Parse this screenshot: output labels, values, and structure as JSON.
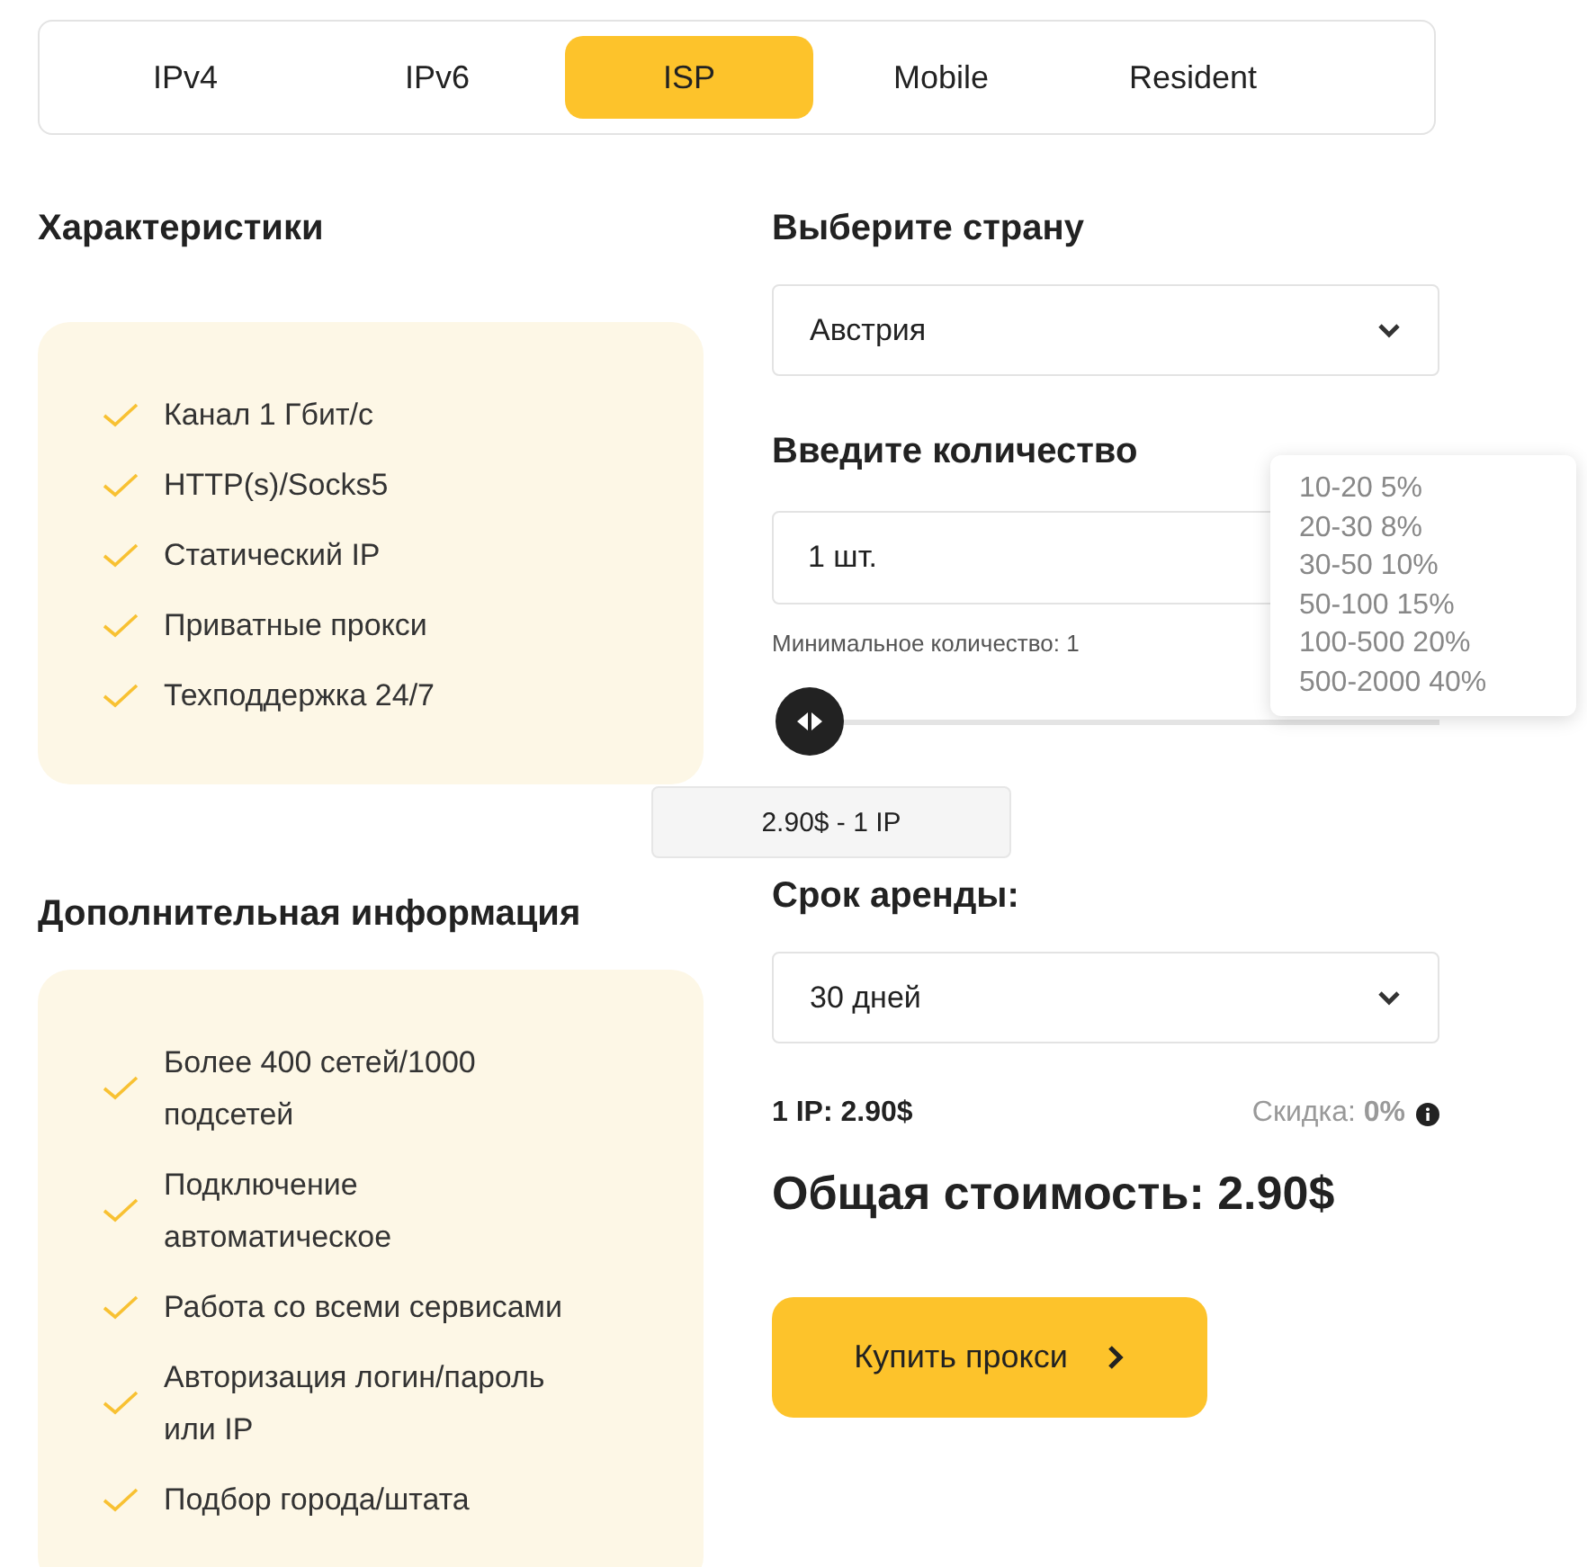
{
  "tabs": [
    {
      "label": "IPv4",
      "selected": false
    },
    {
      "label": "IPv6",
      "selected": false
    },
    {
      "label": "ISP",
      "selected": true
    },
    {
      "label": "Mobile",
      "selected": false
    },
    {
      "label": "Resident",
      "selected": false
    }
  ],
  "features": {
    "title": "Характеристики",
    "items": [
      "Канал 1 Гбит/с",
      "HTTP(s)/Socks5",
      "Статический IP",
      "Приватные прокси",
      "Техподдержка 24/7"
    ]
  },
  "extra_info": {
    "title": "Дополнительная информация",
    "items": [
      "Более 400 сетей/1000 подсетей",
      "Подключение автоматическое",
      "Работа со всеми сервисами",
      "Авторизация логин/пароль или IP",
      "Подбор города/штата"
    ]
  },
  "country": {
    "label": "Выберите страну",
    "value": "Австрия"
  },
  "quantity": {
    "label": "Введите количество",
    "value": "1 шт.",
    "hint": "Минимальное количество: 1",
    "level": 0,
    "price_tooltip": "2.90$ - 1 IP"
  },
  "discount_popup": [
    "10-20 5%",
    "20-30 8%",
    "30-50 10%",
    "50-100 15%",
    "100-500 20%",
    "500-2000 40%"
  ],
  "period": {
    "label": "Срок аренды:",
    "value": "30 дней"
  },
  "unit_price": "1 IP: 2.90$",
  "discount": "Скидка: **0%**",
  "total": "Общая стоимость: 2.90$",
  "buy_button": "Купить прокси"
}
